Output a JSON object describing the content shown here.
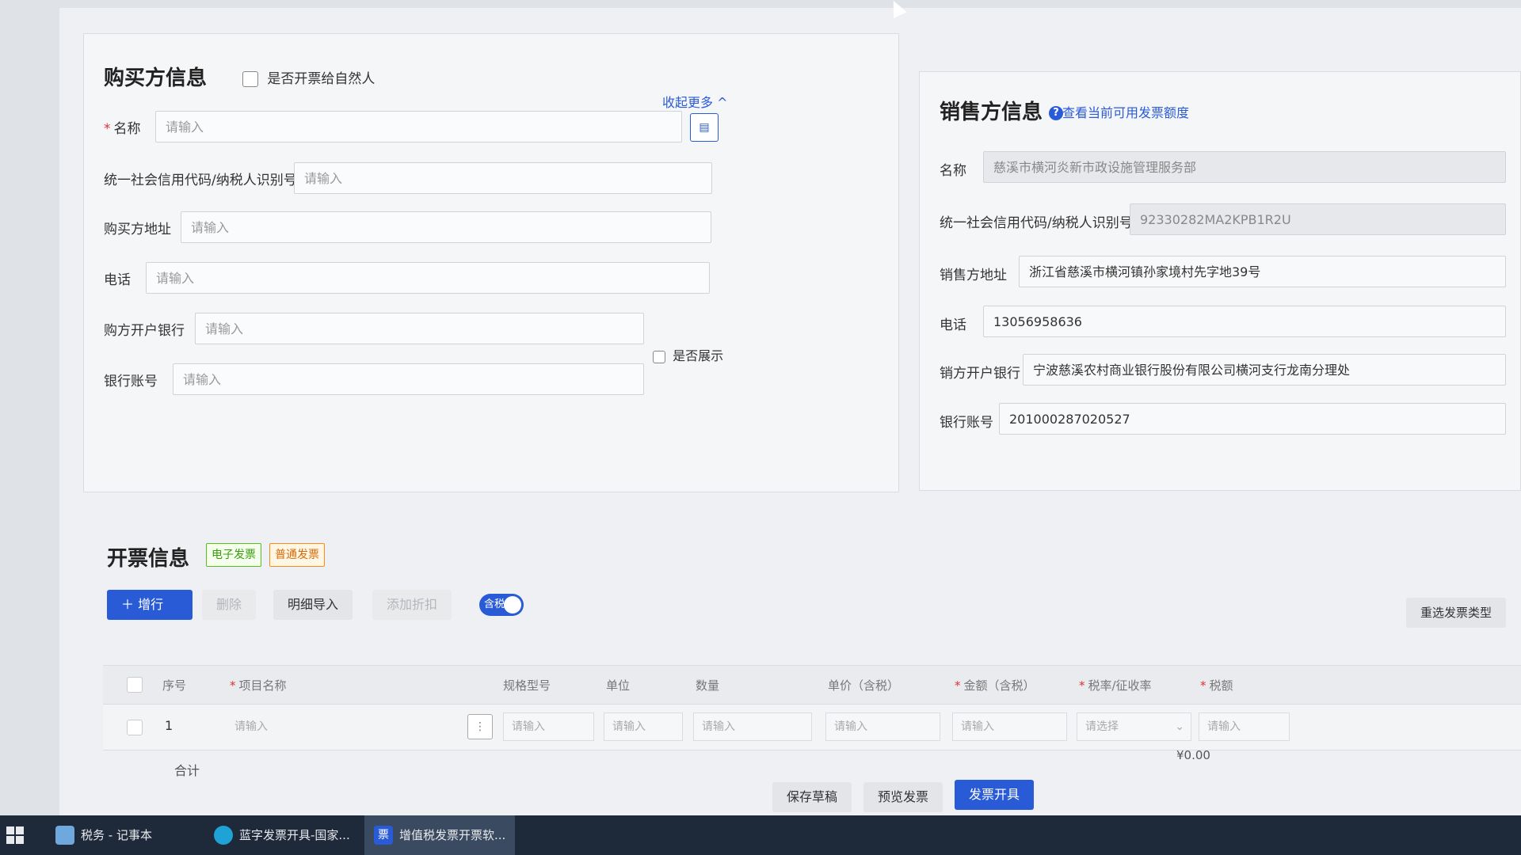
{
  "buyer": {
    "title": "购买方信息",
    "natural_person_label": "是否开票给自然人",
    "collapse_label": "收起更多 ^",
    "fields": {
      "name": {
        "label": "名称",
        "required": "*",
        "placeholder": "请输入"
      },
      "tax_id": {
        "label": "统一社会信用代码/纳税人识别号",
        "placeholder": "请输入"
      },
      "address": {
        "label": "购买方地址",
        "placeholder": "请输入"
      },
      "phone": {
        "label": "电话",
        "placeholder": "请输入"
      },
      "bank": {
        "label": "购方开户银行",
        "placeholder": "请输入"
      },
      "account": {
        "label": "银行账号",
        "placeholder": "请输入"
      }
    },
    "show_label": "是否展示"
  },
  "seller": {
    "title": "销售方信息",
    "quota_link": "查看当前可用发票额度",
    "help_icon": "question-circle-icon",
    "fields": {
      "name": {
        "label": "名称",
        "value": "慈溪市横河炎新市政设施管理服务部"
      },
      "tax_id": {
        "label": "统一社会信用代码/纳税人识别号",
        "value": "92330282MA2KPB1R2U"
      },
      "address": {
        "label": "销售方地址",
        "value": "浙江省慈溪市横河镇孙家境村先字地39号"
      },
      "phone": {
        "label": "电话",
        "value": "13056958636"
      },
      "bank": {
        "label": "销方开户银行",
        "value": "宁波慈溪农村商业银行股份有限公司横河支行龙南分理处"
      },
      "account": {
        "label": "银行账号",
        "value": "201000287020527"
      }
    }
  },
  "invoice": {
    "title": "开票信息",
    "tag_electronic": "电子发票",
    "tag_normal": "普通发票",
    "add_row": "增行",
    "delete": "删除",
    "import_detail": "明细导入",
    "add_discount": "添加折扣",
    "tax_included": "含税",
    "reselect_type": "重选发票类型",
    "columns": [
      "序号",
      "项目名称",
      "规格型号",
      "单位",
      "数量",
      "单价（含税）",
      "金额（含税）",
      "税率/征收率",
      "税额"
    ],
    "required_mark": "*",
    "row": {
      "index": "1",
      "placeholder": "请输入",
      "select_placeholder": "请选择"
    },
    "total_label": "合计",
    "total_value": "¥0.00",
    "save_draft": "保存草稿",
    "preview": "预览发票",
    "issue": "发票开具"
  },
  "taskbar": {
    "items": [
      {
        "label": "税务 - 记事本"
      },
      {
        "label": "蓝字发票开具-国家..."
      },
      {
        "label": "增值税发票开票软..."
      }
    ]
  },
  "colors": {
    "primary": "#2a5bd7",
    "required": "#d33",
    "tag_green": "#389e0d",
    "tag_orange": "#d46b08"
  }
}
